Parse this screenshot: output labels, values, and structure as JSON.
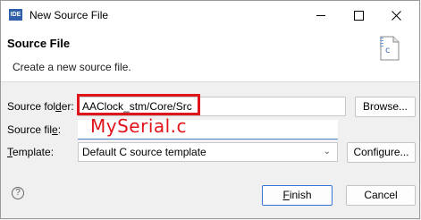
{
  "window": {
    "app_icon_text": "IDE",
    "title": "New Source File"
  },
  "banner": {
    "title": "Source File",
    "description": "Create a new source file.",
    "icon_letter": "c"
  },
  "form": {
    "source_folder": {
      "label_pre": "Source fol",
      "label_mnemonic": "d",
      "label_post": "er:",
      "value": "AAClock_stm/Core/Src",
      "browse_label": "Browse..."
    },
    "source_file": {
      "label_pre": "Source fil",
      "label_mnemonic": "e",
      "label_post": ":",
      "value": ""
    },
    "template": {
      "label_mnemonic": "T",
      "label_post": "emplate:",
      "value": "Default C source template",
      "configure_label": "Configure..."
    }
  },
  "annotation": {
    "overlay_text": "MySerial.c",
    "color": "#e0141b"
  },
  "footer": {
    "finish_mnemonic": "F",
    "finish_rest": "inish",
    "cancel_label": "Cancel"
  }
}
